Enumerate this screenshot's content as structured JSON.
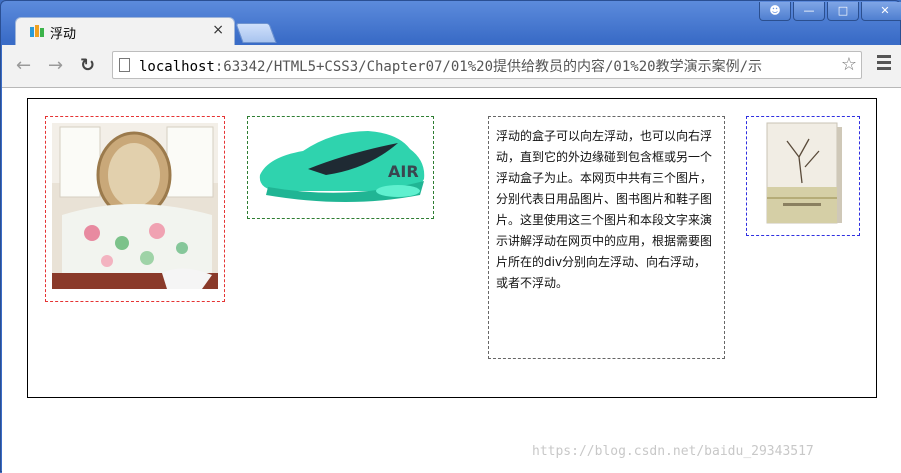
{
  "window": {
    "controls": [
      "user-icon",
      "minimize-icon",
      "maximize-icon",
      "close-icon"
    ]
  },
  "tab": {
    "title": "浮动",
    "close_label": "×"
  },
  "toolbar": {
    "url_host": "localhost",
    "url_path": ":63342/HTML5+CSS3/Chapter07/01%20提供给教员的内容/01%20教学演示案例/示"
  },
  "content": {
    "paragraph": "浮动的盒子可以向左浮动，也可以向右浮动，直到它的外边缘碰到包含框或另一个浮动盒子为止。本网页中共有三个图片，分别代表日用品图片、图书图片和鞋子图片。这里使用这三个图片和本段文字来演示讲解浮动在网页中的应用，根据需要图片所在的div分别向左浮动、向右浮动，或者不浮动。"
  },
  "watermark": "https://blog.csdn.net/baidu_29343517",
  "colors": {
    "bed_border": "#e53333",
    "shoe_border": "#2e7d32",
    "text_border": "#666666",
    "book_border": "#2f2fe0",
    "shoe_color": "#2fd3ae"
  }
}
